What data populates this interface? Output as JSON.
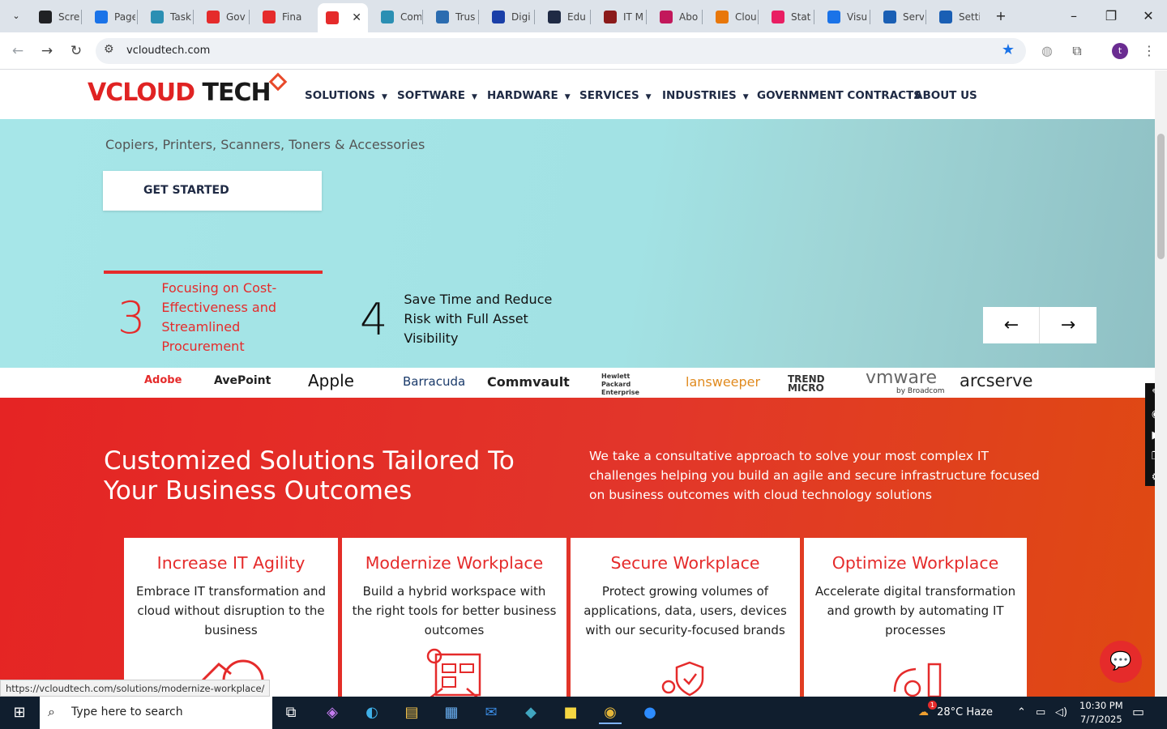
{
  "browser": {
    "tabs": [
      {
        "label": "Scre",
        "fav_color": "#202124"
      },
      {
        "label": "Page",
        "fav_color": "#1a73e8"
      },
      {
        "label": "Task",
        "fav_color": "#2b8fb3"
      },
      {
        "label": "Gov",
        "fav_color": "#e52b2b"
      },
      {
        "label": "Fina",
        "fav_color": "#e52b2b"
      },
      {
        "label": "",
        "fav_color": "#e52b2b"
      },
      {
        "label": "Com",
        "fav_color": "#2b8fb3"
      },
      {
        "label": "Trus",
        "fav_color": "#2b6cb0"
      },
      {
        "label": "Digi",
        "fav_color": "#1a3fa8"
      },
      {
        "label": "Edu",
        "fav_color": "#1f2a44"
      },
      {
        "label": "IT M",
        "fav_color": "#8b1a1a"
      },
      {
        "label": "Abo",
        "fav_color": "#c2185b"
      },
      {
        "label": "Clou",
        "fav_color": "#e8770a"
      },
      {
        "label": "Stat",
        "fav_color": "#e91e63"
      },
      {
        "label": "Visu",
        "fav_color": "#1a73e8"
      },
      {
        "label": "Serv",
        "fav_color": "#1a5fb4"
      },
      {
        "label": "Setti",
        "fav_color": "#1a5fb4"
      }
    ],
    "tab_close": "✕",
    "new_tab": "+",
    "url": "vcloudtech.com",
    "profile_initial": "t",
    "status_url": "https://vcloudtech.com/solutions/modernize-workplace/"
  },
  "site": {
    "logo_v": "V",
    "logo_rest": "CLOUD TECH",
    "menu": [
      {
        "label": "SOLUTIONS",
        "caret": "▼"
      },
      {
        "label": "SOFTWARE",
        "caret": "▼"
      },
      {
        "label": "HARDWARE",
        "caret": "▼"
      },
      {
        "label": "SERVICES",
        "caret": "▼"
      },
      {
        "label": "INDUSTRIES",
        "caret": "▼"
      },
      {
        "label": "GOVERNMENT CONTRACTS",
        "caret": ""
      },
      {
        "label": "ABOUT US",
        "caret": ""
      }
    ],
    "hero": {
      "subtitle": "Copiers, Printers, Scanners, Toners & Accessories",
      "cta": "GET STARTED",
      "features": [
        {
          "num": "3",
          "text": "Focusing on Cost-Effectiveness and Streamlined Procurement",
          "color": "#e52b2b"
        },
        {
          "num": "4",
          "text": "Save Time and Reduce Risk with Full Asset Visibility",
          "color": "#111111"
        }
      ],
      "prev": "←",
      "next": "→"
    },
    "brands": [
      "Adobe",
      "AvePoint",
      "Apple",
      "Barracuda",
      "Commvault",
      "Hewlett Packard Enterprise",
      "lansweeper",
      "TREND MICRO",
      "vmware",
      "by Broadcom",
      "arcserve"
    ],
    "section": {
      "heading": "Customized Solutions Tailored To Your Business Outcomes",
      "paragraph": "We take a consultative approach to solve your most complex IT challenges helping you build an agile and secure infrastructure focused on business outcomes with cloud technology solutions"
    },
    "cards": [
      {
        "title": "Increase IT Agility",
        "desc": "Embrace IT transformation and cloud without disruption to the business"
      },
      {
        "title": "Modernize Workplace",
        "desc": "Build a hybrid workspace with the right tools for better business outcomes"
      },
      {
        "title": "Secure Workplace",
        "desc": "Protect growing volumes of applications, data, users, devices with our security-focused brands"
      },
      {
        "title": "Optimize Workplace",
        "desc": "Accelerate digital transformation and growth by automating IT processes"
      }
    ]
  },
  "taskbar": {
    "search_placeholder": "Type here to search",
    "weather": "28°C  Haze",
    "time": "10:30 PM",
    "date": "7/7/2025",
    "weather_badge": "1"
  }
}
